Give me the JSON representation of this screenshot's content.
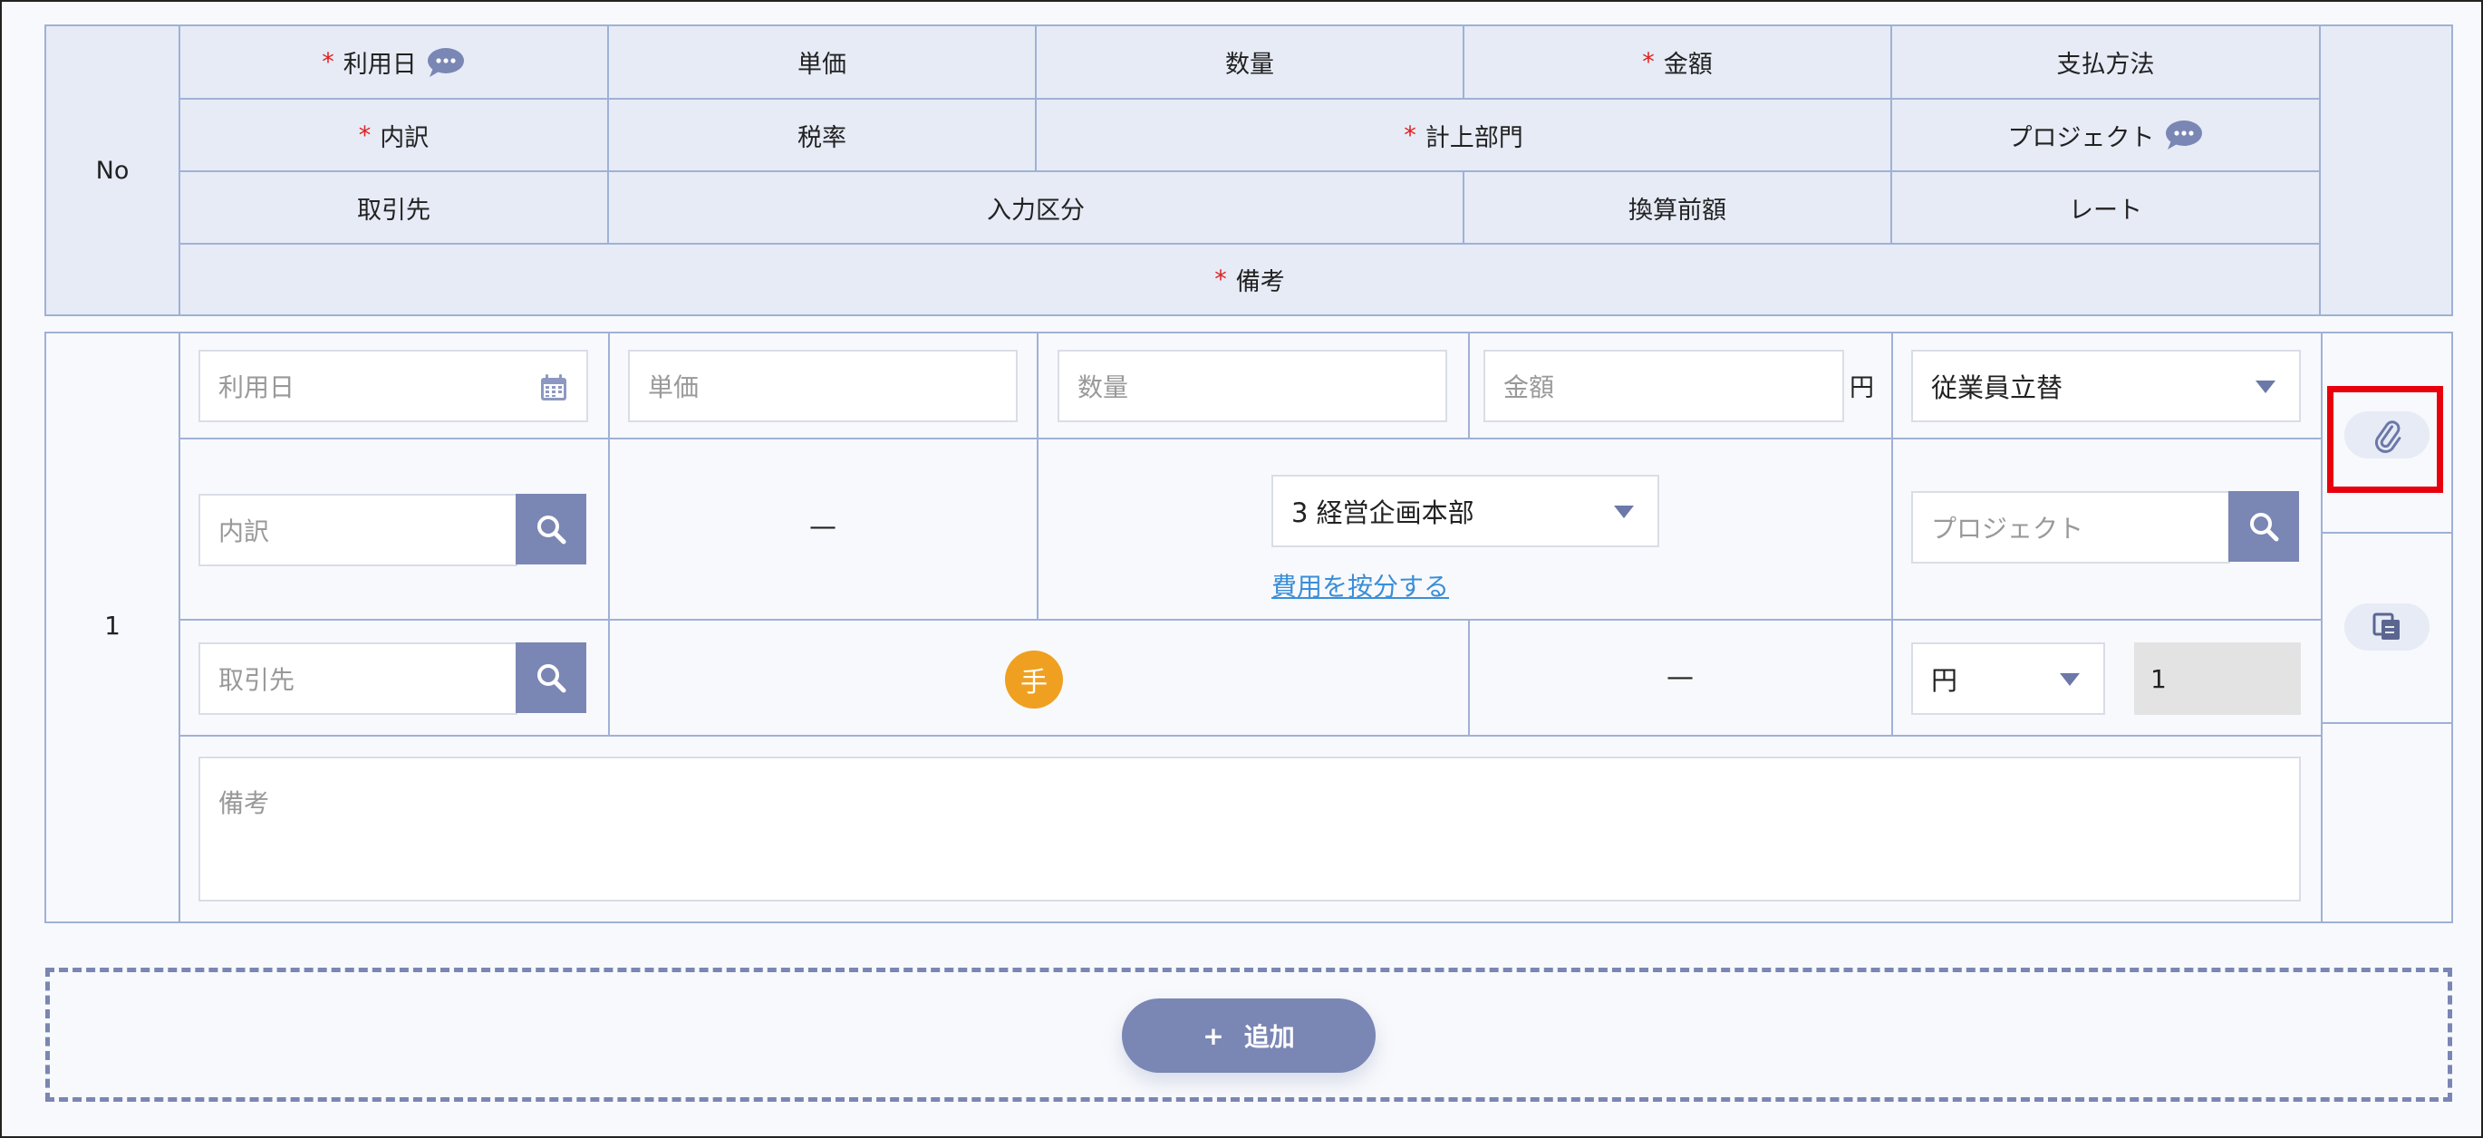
{
  "header": {
    "no": "No",
    "row1": {
      "date": "利用日",
      "unit_price": "単価",
      "quantity": "数量",
      "amount": "金額",
      "payment_method": "支払方法"
    },
    "row2": {
      "breakdown": "内訳",
      "tax_rate": "税率",
      "department": "計上部門",
      "project": "プロジェクト"
    },
    "row3": {
      "vendor": "取引先",
      "input_type": "入力区分",
      "pre_conversion": "換算前額",
      "rate": "レート"
    },
    "row4": {
      "remarks": "備考"
    },
    "required_mark": "*"
  },
  "row": {
    "number": "1",
    "date_placeholder": "利用日",
    "unit_price_placeholder": "単価",
    "quantity_placeholder": "数量",
    "amount_placeholder": "金額",
    "amount_unit": "円",
    "payment_method_value": "従業員立替",
    "breakdown_placeholder": "内訳",
    "tax_rate_value": "—",
    "department_value": "3 経営企画本部",
    "allocate_link": "費用を按分する",
    "project_placeholder": "プロジェクト",
    "vendor_placeholder": "取引先",
    "input_type_badge": "手",
    "pre_conversion_value": "—",
    "currency_value": "円",
    "rate_value": "1",
    "remarks_placeholder": "備考"
  },
  "add_button": {
    "plus": "+",
    "label": "追加"
  },
  "colors": {
    "header_bg": "#e6ebf6",
    "border": "#9fb1d6",
    "accent": "#7a86b4",
    "required": "#e02020",
    "link": "#3a8ed8",
    "badge": "#f0a020",
    "highlight": "#e8000c"
  }
}
